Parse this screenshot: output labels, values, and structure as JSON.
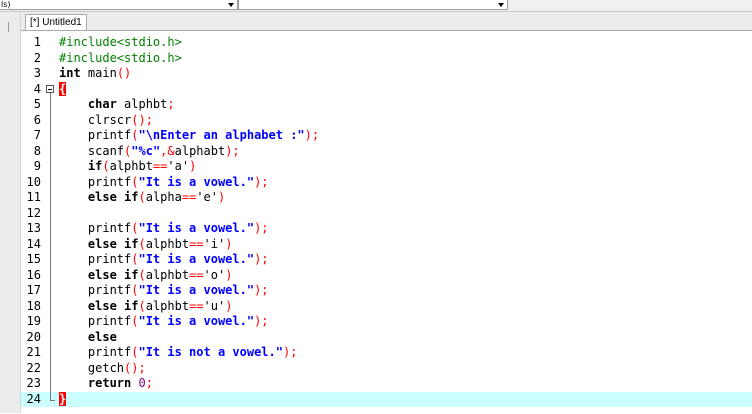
{
  "toolbar": {
    "combo1": {
      "value": "ls)"
    },
    "combo2": {
      "value": ""
    }
  },
  "tab": {
    "label": "[*] Untitled1"
  },
  "colors": {
    "current_line": "#ccffff",
    "preprocessor": "#008000",
    "string": "#0000ff",
    "symbol": "#ff0000",
    "number": "#800080",
    "brace_highlight": "#ff0000"
  },
  "editor": {
    "current_line": 24,
    "lines": [
      {
        "n": "1",
        "fold": "",
        "tokens": [
          [
            "pp",
            "#include<stdio.h>"
          ]
        ]
      },
      {
        "n": "2",
        "fold": "",
        "tokens": [
          [
            "pp",
            "#include<stdio.h>"
          ]
        ]
      },
      {
        "n": "3",
        "fold": "",
        "tokens": [
          [
            "kw",
            "int"
          ],
          [
            "pl",
            " main"
          ],
          [
            "sym",
            "()"
          ]
        ]
      },
      {
        "n": "4",
        "fold": "start",
        "tokens": [
          [
            "brace",
            "{"
          ]
        ]
      },
      {
        "n": "5",
        "fold": "line",
        "tokens": [
          [
            "pl",
            "    "
          ],
          [
            "kw",
            "char"
          ],
          [
            "pl",
            " alphbt"
          ],
          [
            "sym",
            ";"
          ]
        ]
      },
      {
        "n": "6",
        "fold": "line",
        "tokens": [
          [
            "pl",
            "    clrscr"
          ],
          [
            "sym",
            "();"
          ]
        ]
      },
      {
        "n": "7",
        "fold": "line",
        "tokens": [
          [
            "pl",
            "    printf"
          ],
          [
            "sym",
            "("
          ],
          [
            "str",
            "\"\\nEnter an alphabet :\""
          ],
          [
            "sym",
            ");"
          ]
        ]
      },
      {
        "n": "8",
        "fold": "line",
        "tokens": [
          [
            "pl",
            "    scanf"
          ],
          [
            "sym",
            "("
          ],
          [
            "str",
            "\"%c\""
          ],
          [
            "sym",
            ",&"
          ],
          [
            "pl",
            "alphabt"
          ],
          [
            "sym",
            ");"
          ]
        ]
      },
      {
        "n": "9",
        "fold": "line",
        "tokens": [
          [
            "pl",
            "    "
          ],
          [
            "kw",
            "if"
          ],
          [
            "sym",
            "("
          ],
          [
            "pl",
            "alphbt"
          ],
          [
            "sym",
            "=="
          ],
          [
            "chr",
            "'a'"
          ],
          [
            "sym",
            ")"
          ]
        ]
      },
      {
        "n": "10",
        "fold": "line",
        "tokens": [
          [
            "pl",
            "    printf"
          ],
          [
            "sym",
            "("
          ],
          [
            "str",
            "\"It is a vowel.\""
          ],
          [
            "sym",
            ");"
          ]
        ]
      },
      {
        "n": "11",
        "fold": "line",
        "tokens": [
          [
            "pl",
            "    "
          ],
          [
            "kw",
            "else"
          ],
          [
            "pl",
            " "
          ],
          [
            "kw",
            "if"
          ],
          [
            "sym",
            "("
          ],
          [
            "pl",
            "alpha"
          ],
          [
            "sym",
            "=="
          ],
          [
            "chr",
            "'e'"
          ],
          [
            "sym",
            ")"
          ]
        ]
      },
      {
        "n": "12",
        "fold": "line",
        "tokens": []
      },
      {
        "n": "13",
        "fold": "line",
        "tokens": [
          [
            "pl",
            "    printf"
          ],
          [
            "sym",
            "("
          ],
          [
            "str",
            "\"It is a vowel.\""
          ],
          [
            "sym",
            ");"
          ]
        ]
      },
      {
        "n": "14",
        "fold": "line",
        "tokens": [
          [
            "pl",
            "    "
          ],
          [
            "kw",
            "else"
          ],
          [
            "pl",
            " "
          ],
          [
            "kw",
            "if"
          ],
          [
            "sym",
            "("
          ],
          [
            "pl",
            "alphbt"
          ],
          [
            "sym",
            "=="
          ],
          [
            "chr",
            "'i'"
          ],
          [
            "sym",
            ")"
          ]
        ]
      },
      {
        "n": "15",
        "fold": "line",
        "tokens": [
          [
            "pl",
            "    printf"
          ],
          [
            "sym",
            "("
          ],
          [
            "str",
            "\"It is a vowel.\""
          ],
          [
            "sym",
            ");"
          ]
        ]
      },
      {
        "n": "16",
        "fold": "line",
        "tokens": [
          [
            "pl",
            "    "
          ],
          [
            "kw",
            "else"
          ],
          [
            "pl",
            " "
          ],
          [
            "kw",
            "if"
          ],
          [
            "sym",
            "("
          ],
          [
            "pl",
            "alphbt"
          ],
          [
            "sym",
            "=="
          ],
          [
            "chr",
            "'o'"
          ],
          [
            "sym",
            ")"
          ]
        ]
      },
      {
        "n": "17",
        "fold": "line",
        "tokens": [
          [
            "pl",
            "    printf"
          ],
          [
            "sym",
            "("
          ],
          [
            "str",
            "\"It is a vowel.\""
          ],
          [
            "sym",
            ");"
          ]
        ]
      },
      {
        "n": "18",
        "fold": "line",
        "tokens": [
          [
            "pl",
            "    "
          ],
          [
            "kw",
            "else"
          ],
          [
            "pl",
            " "
          ],
          [
            "kw",
            "if"
          ],
          [
            "sym",
            "("
          ],
          [
            "pl",
            "alphbt"
          ],
          [
            "sym",
            "=="
          ],
          [
            "chr",
            "'u'"
          ],
          [
            "sym",
            ")"
          ]
        ]
      },
      {
        "n": "19",
        "fold": "line",
        "tokens": [
          [
            "pl",
            "    printf"
          ],
          [
            "sym",
            "("
          ],
          [
            "str",
            "\"It is a vowel.\""
          ],
          [
            "sym",
            ");"
          ]
        ]
      },
      {
        "n": "20",
        "fold": "line",
        "tokens": [
          [
            "pl",
            "    "
          ],
          [
            "kw",
            "else"
          ]
        ]
      },
      {
        "n": "21",
        "fold": "line",
        "tokens": [
          [
            "pl",
            "    printf"
          ],
          [
            "sym",
            "("
          ],
          [
            "str",
            "\"It is not a vowel.\""
          ],
          [
            "sym",
            ");"
          ]
        ]
      },
      {
        "n": "22",
        "fold": "line",
        "tokens": [
          [
            "pl",
            "    getch"
          ],
          [
            "sym",
            "();"
          ]
        ]
      },
      {
        "n": "23",
        "fold": "line",
        "tokens": [
          [
            "pl",
            "    "
          ],
          [
            "kw",
            "return"
          ],
          [
            "pl",
            " "
          ],
          [
            "num",
            "0"
          ],
          [
            "sym",
            ";"
          ]
        ]
      },
      {
        "n": "24",
        "fold": "end",
        "tokens": [
          [
            "brace",
            "}"
          ]
        ]
      }
    ]
  }
}
